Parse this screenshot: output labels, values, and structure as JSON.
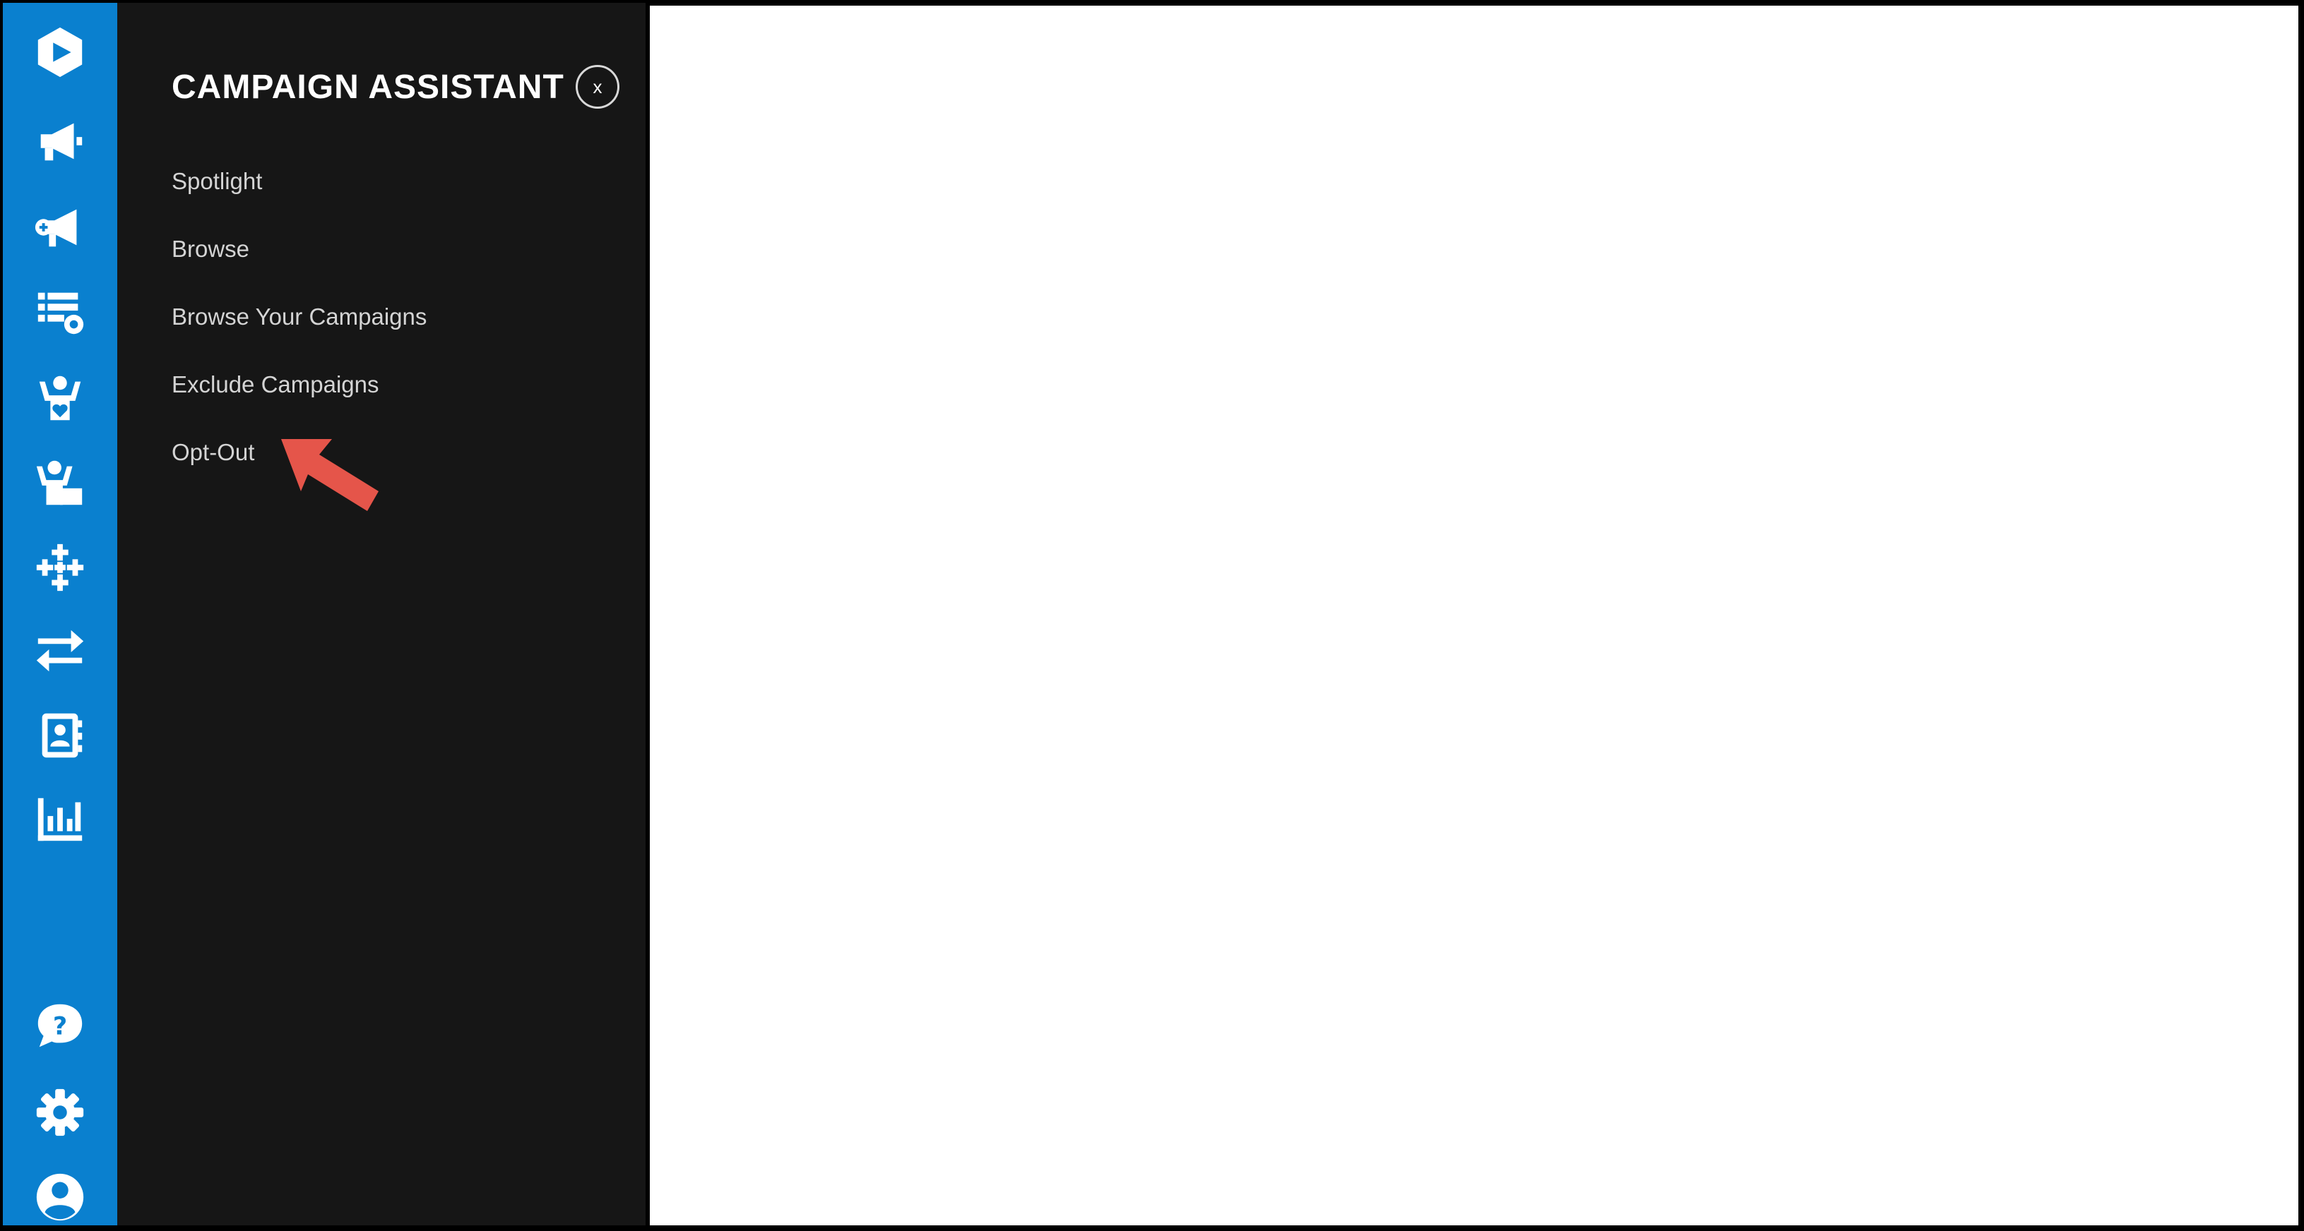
{
  "theme": {
    "rail_color": "#0a80cf",
    "panel_color": "#161616",
    "annotation_arrow_color": "#e5554a"
  },
  "sidebar": {
    "icons": [
      "logo-icon",
      "megaphone-icon",
      "megaphone-plus-icon",
      "list-settings-icon",
      "volunteer-heart-icon",
      "volunteer-board-icon",
      "sparkle-grid-icon",
      "transfer-arrows-icon",
      "contact-book-icon",
      "bar-chart-icon",
      "help-chat-icon",
      "settings-gear-icon",
      "user-account-icon"
    ]
  },
  "panel": {
    "title": "CAMPAIGN ASSISTANT",
    "close_label": "x",
    "menu": [
      "Spotlight",
      "Browse",
      "Browse Your Campaigns",
      "Exclude Campaigns",
      "Opt-Out"
    ]
  }
}
